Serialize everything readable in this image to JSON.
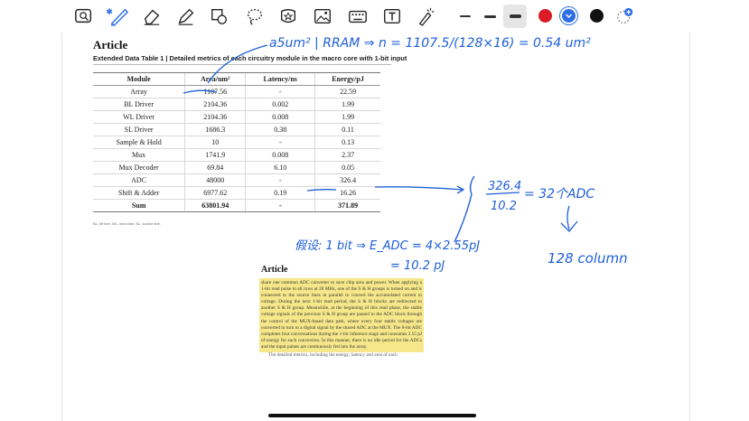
{
  "toolbar": {
    "tools": [
      "lasso-zoom-icon",
      "pen-icon",
      "eraser-icon",
      "highlighter-icon",
      "shapes-icon",
      "lasso-icon",
      "sticker-icon",
      "image-icon",
      "keyboard-icon",
      "text-box-icon",
      "laser-pointer-icon"
    ],
    "strokes": [
      "thin",
      "medium",
      "thick"
    ],
    "colors": [
      "#d81b24",
      "#2f6fe6",
      "#111111"
    ]
  },
  "doc": {
    "title": "Article",
    "caption": "Extended Data Table 1 | Detailed metrics of each circuitry module in the macro core with 1-bit input",
    "headers": [
      "Module",
      "Area/um²",
      "Latency/ns",
      "Energy/pJ"
    ],
    "rows": [
      [
        "Array",
        "1107.56",
        "-",
        "22.59"
      ],
      [
        "BL Driver",
        "2104.36",
        "0.002",
        "1.99"
      ],
      [
        "WL Driver",
        "2104.36",
        "0.008",
        "1.99"
      ],
      [
        "SL Driver",
        "1686.3",
        "0.38",
        "0.11"
      ],
      [
        "Sample & Hold",
        "10",
        "-",
        "0.13"
      ],
      [
        "Mux",
        "1741.9",
        "0.008",
        "2.37"
      ],
      [
        "Mux Decoder",
        "69.84",
        "6.10",
        "0.05"
      ],
      [
        "ADC",
        "48000",
        "-",
        "326.4"
      ],
      [
        "Shift & Adder",
        "6977.62",
        "0.19",
        "16.26"
      ],
      [
        "Sum",
        "63801.94",
        "-",
        "371.89"
      ]
    ],
    "footnote": "BL, bit line; WL, word line; SL, source line."
  },
  "doc2": {
    "title": "Article",
    "body": "share one common ADC converter to save chip area and power. When applying a 1-bit read pulse to all rows at 20 MHz, one of the S & H groups is turned on and is connected to the source lines in parallel to convert the accumulated current to voltage. During the next 1-bit read period, the S & H blocks are redirected to another S & H group. Meanwhile, at the beginning of this read phase, the stable voltage signals of the previous S & H group are passed to the ADC block through the control of the MUX-based data path, where every four stable voltages are converted in turn to a digital signal by the shared ADC at the MUX. The 8-bit ADC completes four conversations during the 1-bit inference stage and consumes 2.55 pJ of energy for each conversion. In this manner, there is no idle period for the ADCs and the input pulses are continuously fed into the array.",
    "tail": "The detailed metrics, including the energy, latency and area of each"
  },
  "annotations": {
    "top": "a5um² | RRAM ⇒ n = 1107.5/(128×16) = 0.54 um²",
    "ratio_num": "326.4",
    "ratio_den": "10.2",
    "ratio_result": "= 32个ADC",
    "column": "128 column",
    "note_line1": "假设: 1 bit ⇒ E_ADC = 4×2.55pJ",
    "note_line2": "= 10.2 pJ"
  }
}
